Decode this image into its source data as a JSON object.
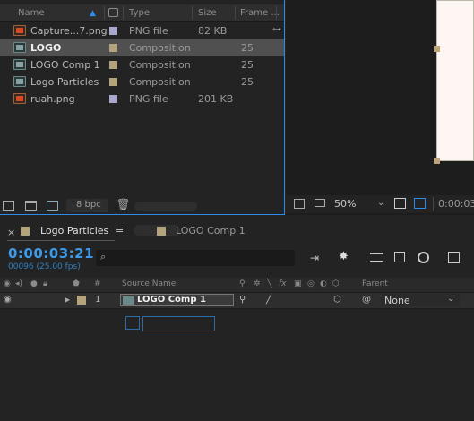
{
  "project": {
    "columns": {
      "name": "Name",
      "type": "Type",
      "size": "Size",
      "frame_rate": "Frame ..."
    },
    "items": [
      {
        "name": "Capture...7.png",
        "type": "PNG file",
        "size": "82 KB",
        "rate": "",
        "kind": "png",
        "label_color": "#a8a8cc",
        "selected": false
      },
      {
        "name": "LOGO",
        "type": "Composition",
        "size": "",
        "rate": "25",
        "kind": "comp",
        "label_color": "#b4a47c",
        "selected": true
      },
      {
        "name": "LOGO Comp 1",
        "type": "Composition",
        "size": "",
        "rate": "25",
        "kind": "comp",
        "label_color": "#b4a47c",
        "selected": false
      },
      {
        "name": "Logo Particles",
        "type": "Composition",
        "size": "",
        "rate": "25",
        "kind": "comp",
        "label_color": "#b4a47c",
        "selected": false
      },
      {
        "name": "ruah.png",
        "type": "PNG file",
        "size": "201 KB",
        "rate": "",
        "kind": "png",
        "label_color": "#a8a8cc",
        "selected": false
      }
    ],
    "footer": {
      "bit_depth": "8 bpc"
    }
  },
  "viewer": {
    "zoom": "50%",
    "timecode": "0:00:03:"
  },
  "timeline": {
    "tabs": [
      {
        "label": "Logo Particles",
        "active": true,
        "label_color": "#b4a47c"
      },
      {
        "label": "LOGO Comp 1",
        "active": false,
        "label_color": "#b4a47c"
      }
    ],
    "timecode": "0:00:03:21",
    "frames_fps": "00096 (25.00 fps)",
    "header": {
      "source_name": "Source Name",
      "parent": "Parent",
      "number_col": "#"
    },
    "layers": [
      {
        "index": "1",
        "name": "LOGO Comp 1",
        "parent": "None",
        "label_color": "#b4a47c"
      }
    ]
  },
  "colors": {
    "accent_blue": "#2d8ceb",
    "timecode_blue": "#3d9ae8",
    "selection": "#505050"
  }
}
